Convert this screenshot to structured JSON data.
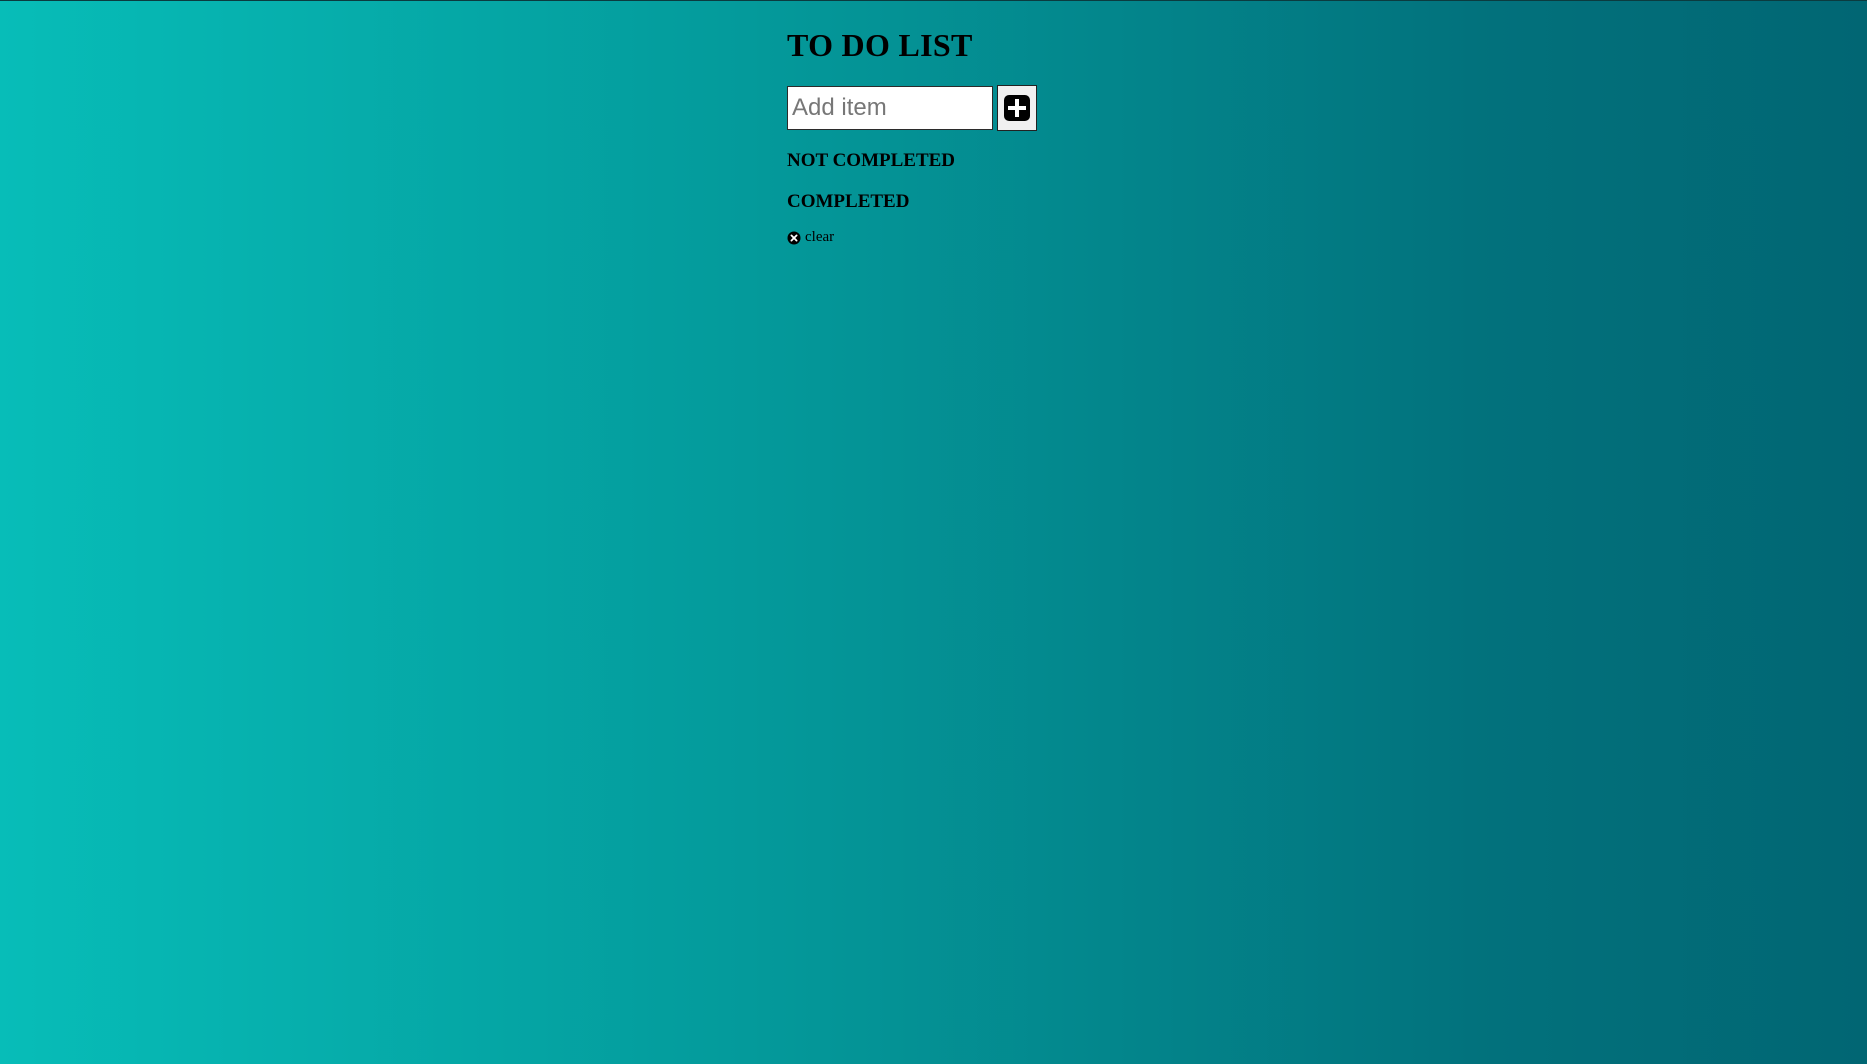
{
  "app": {
    "title": "TO DO LIST"
  },
  "add_item": {
    "placeholder": "Add item",
    "value": "",
    "button_icon": "plus-square-icon"
  },
  "sections": {
    "not_completed_heading": "NOT COMPLETED",
    "completed_heading": "COMPLETED",
    "not_completed_items": [],
    "completed_items": []
  },
  "clear": {
    "label": "clear",
    "icon": "times-circle-icon"
  },
  "colors": {
    "background_start": "#07bdb8",
    "background_end": "#016673",
    "text": "#000000"
  }
}
